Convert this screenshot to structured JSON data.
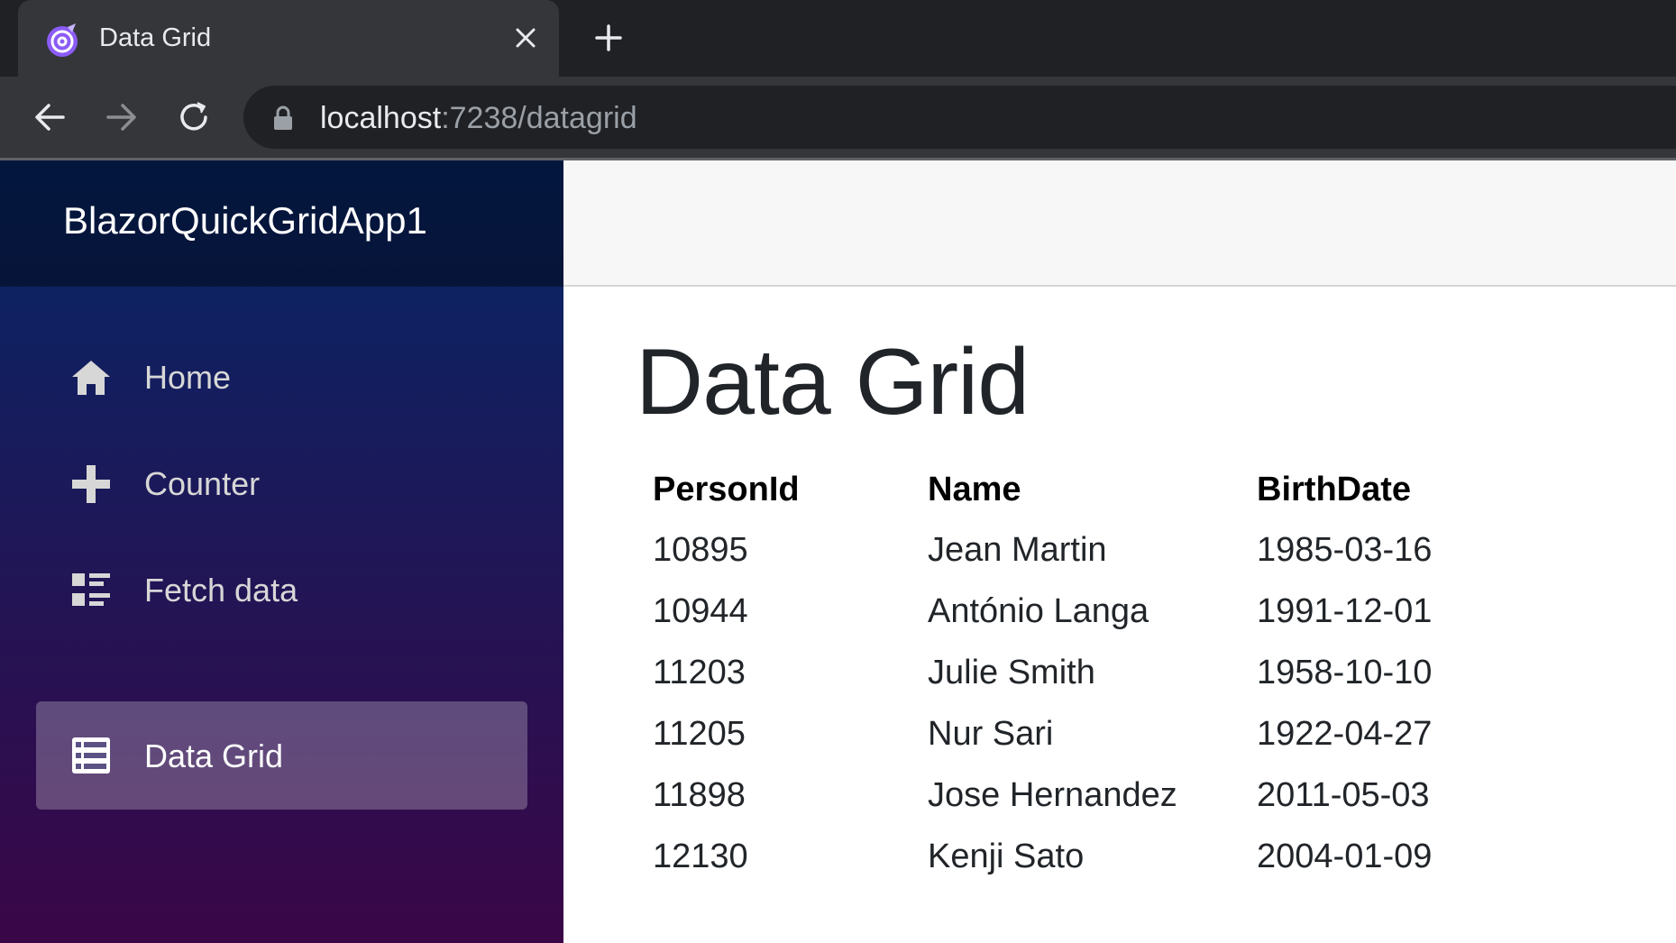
{
  "browser": {
    "tab_title": "Data Grid",
    "url_host": "localhost",
    "url_rest": ":7238/datagrid"
  },
  "sidebar": {
    "brand": "BlazorQuickGridApp1",
    "items": [
      {
        "label": "Home",
        "icon": "home-icon",
        "active": false
      },
      {
        "label": "Counter",
        "icon": "plus-icon",
        "active": false
      },
      {
        "label": "Fetch data",
        "icon": "list-rich-icon",
        "active": false
      },
      {
        "label": "Data Grid",
        "icon": "table-icon",
        "active": true
      }
    ]
  },
  "main": {
    "title": "Data Grid",
    "grid": {
      "columns": [
        "PersonId",
        "Name",
        "BirthDate"
      ],
      "rows": [
        [
          "10895",
          "Jean Martin",
          "1985-03-16"
        ],
        [
          "10944",
          "António Langa",
          "1991-12-01"
        ],
        [
          "11203",
          "Julie Smith",
          "1958-10-10"
        ],
        [
          "11205",
          "Nur Sari",
          "1922-04-27"
        ],
        [
          "11898",
          "Jose Hernandez",
          "2011-05-03"
        ],
        [
          "12130",
          "Kenji Sato",
          "2004-01-09"
        ]
      ]
    }
  },
  "colors": {
    "sidebar_top": "#052767",
    "sidebar_bottom": "#3a0647",
    "active_item": "rgba(255,255,255,0.25)"
  }
}
